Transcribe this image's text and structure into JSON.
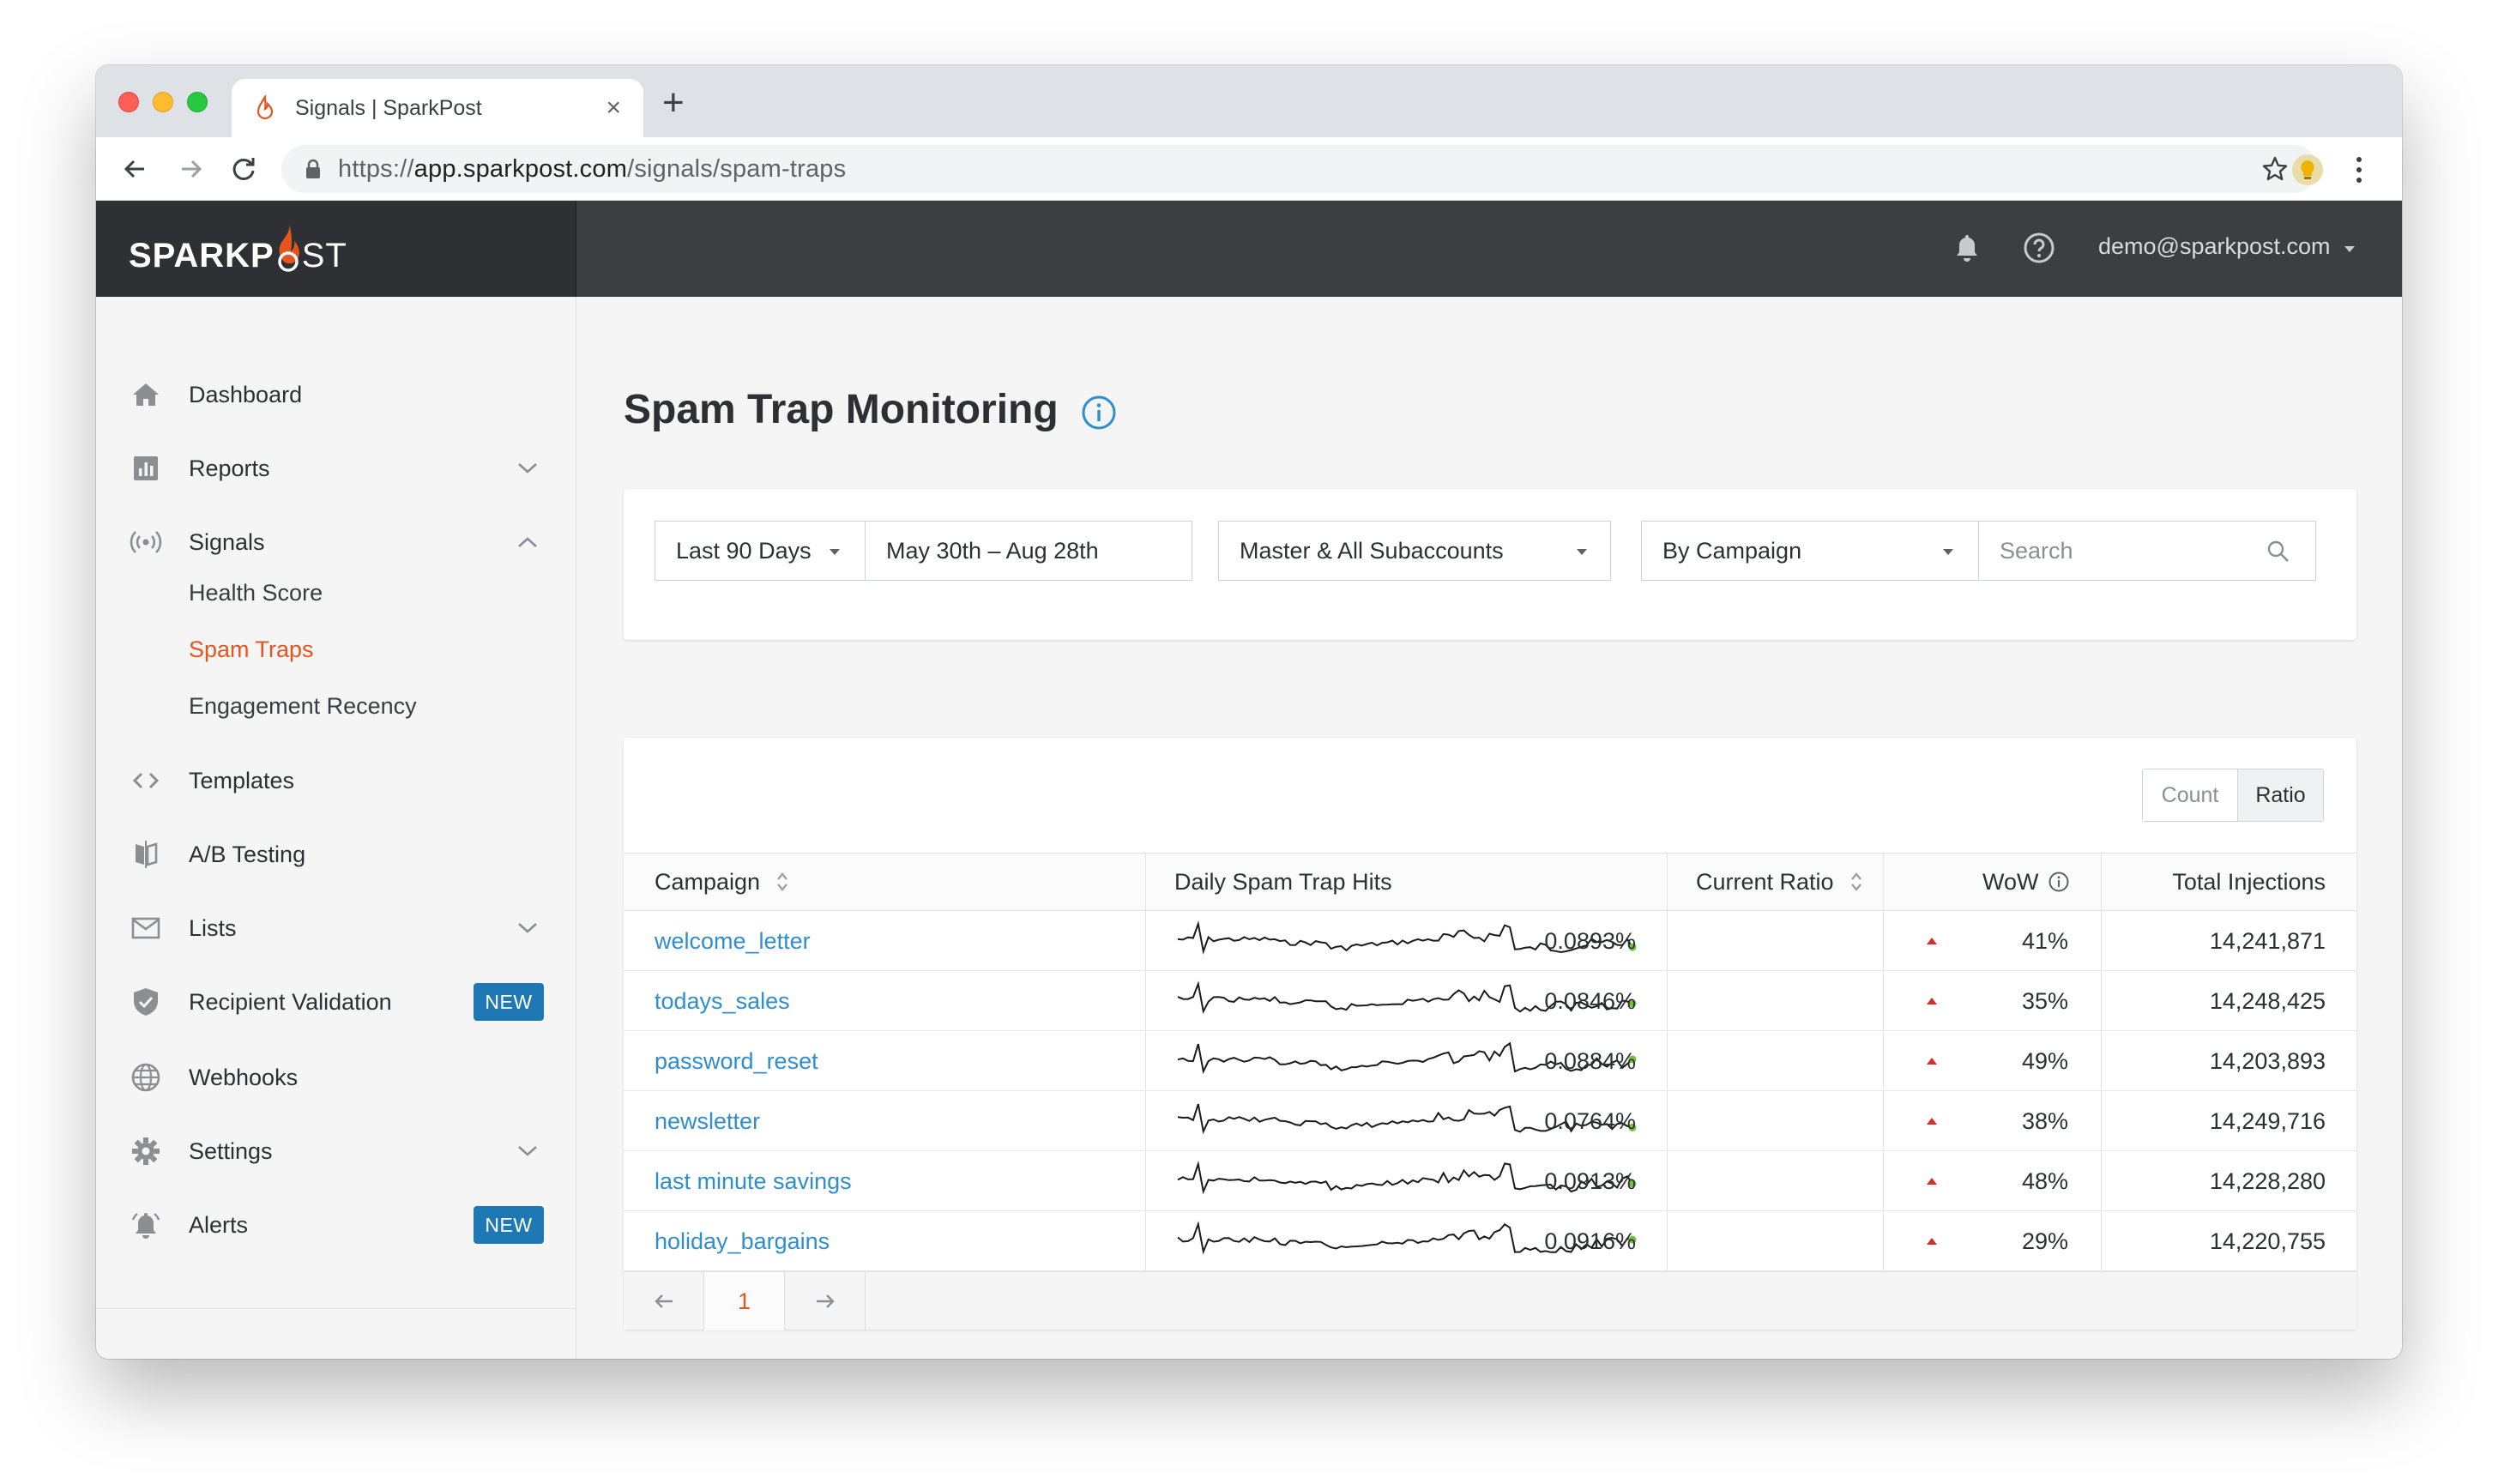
{
  "browser": {
    "tab_title": "Signals | SparkPost",
    "url_scheme": "https://",
    "url_host": "app.sparkpost.com",
    "url_path": "/signals/spam-traps",
    "icons": [
      "back-arrow-icon",
      "forward-arrow-icon",
      "reload-icon",
      "lock-icon",
      "star-icon",
      "extension-icon",
      "kebab-menu-icon"
    ]
  },
  "header": {
    "logo_bold": "SPARKP",
    "logo_light": "ST",
    "user": "demo@sparkpost.com",
    "icons": [
      "bell-icon",
      "help-icon",
      "caret-down-icon"
    ]
  },
  "sidebar": {
    "items": [
      {
        "label": "Dashboard",
        "icon": "home-icon"
      },
      {
        "label": "Reports",
        "icon": "bar-chart-icon"
      },
      {
        "label": "Signals",
        "icon": "signal-icon"
      },
      {
        "label": "Templates",
        "icon": "code-icon"
      },
      {
        "label": "A/B Testing",
        "icon": "ab-testing-icon"
      },
      {
        "label": "Lists",
        "icon": "mail-icon"
      },
      {
        "label": "Recipient Validation",
        "icon": "shield-check-icon",
        "badge": "NEW"
      },
      {
        "label": "Webhooks",
        "icon": "globe-icon"
      },
      {
        "label": "Settings",
        "icon": "gear-icon"
      },
      {
        "label": "Alerts",
        "icon": "alert-bell-icon",
        "badge": "NEW"
      }
    ],
    "signals_sub": [
      "Health Score",
      "Spam Traps",
      "Engagement Recency"
    ],
    "active_sub": "Spam Traps"
  },
  "page": {
    "title": "Spam Trap Monitoring",
    "filters": {
      "range": "Last 90 Days",
      "dates": "May 30th – Aug 28th",
      "subaccount": "Master & All Subaccounts",
      "group_by": "By Campaign",
      "search_placeholder": "Search"
    },
    "toggle": {
      "count": "Count",
      "ratio": "Ratio",
      "selected": "Ratio"
    },
    "columns": [
      "Campaign",
      "Daily Spam Trap Hits",
      "Current Ratio",
      "WoW",
      "Total Injections"
    ],
    "rows": [
      {
        "campaign": "welcome_letter",
        "ratio": "0.0893%",
        "wow": "41%",
        "total": "14,241,871"
      },
      {
        "campaign": "todays_sales",
        "ratio": "0.0846%",
        "wow": "35%",
        "total": "14,248,425"
      },
      {
        "campaign": "password_reset",
        "ratio": "0.0884%",
        "wow": "49%",
        "total": "14,203,893"
      },
      {
        "campaign": "newsletter",
        "ratio": "0.0764%",
        "wow": "38%",
        "total": "14,249,716"
      },
      {
        "campaign": "last minute savings",
        "ratio": "0.0913%",
        "wow": "48%",
        "total": "14,228,280"
      },
      {
        "campaign": "holiday_bargains",
        "ratio": "0.0916%",
        "wow": "29%",
        "total": "14,220,755"
      }
    ],
    "pager": {
      "current": "1"
    },
    "colors": {
      "accent": "#e5561f",
      "link": "#2e8ecf",
      "badge": "#1e78b4",
      "up": "#d0312d",
      "spark_end": "#72c23e"
    }
  }
}
